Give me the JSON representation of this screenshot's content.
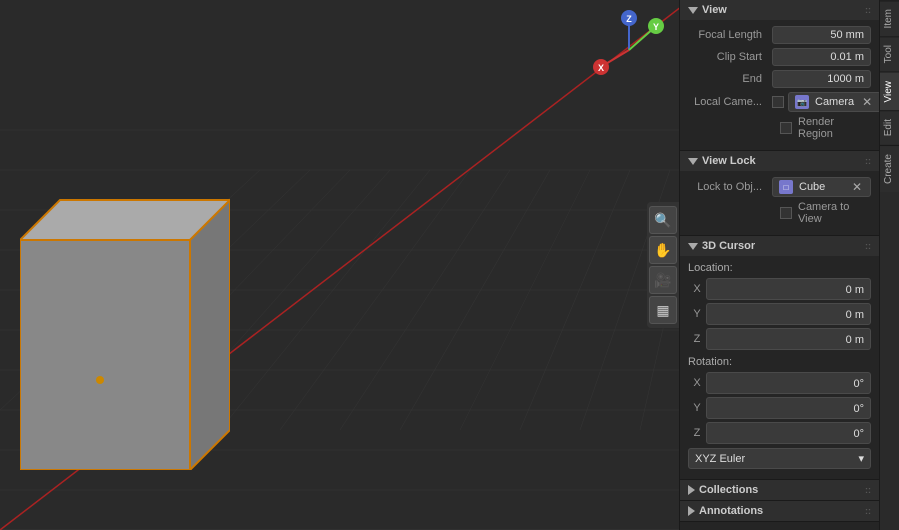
{
  "viewport": {
    "background": "#2a2a2a",
    "grid_color": "#363636",
    "red_line_color": "#cc3333"
  },
  "nav_gizmo": {
    "x_label": "X",
    "y_label": "Y",
    "z_label": "Z",
    "x_color": "#cc3333",
    "y_color": "#66cc44",
    "z_color": "#4466cc"
  },
  "toolbar_buttons": [
    {
      "icon": "🔍",
      "name": "zoom"
    },
    {
      "icon": "✋",
      "name": "pan"
    },
    {
      "icon": "🎥",
      "name": "camera"
    },
    {
      "icon": "▦",
      "name": "grid"
    }
  ],
  "right_panel": {
    "tabs": [
      "Item",
      "Tool",
      "View",
      "Edit",
      "Create"
    ],
    "sections": {
      "view": {
        "title": "View",
        "focal_length_label": "Focal Length",
        "focal_length_value": "50 mm",
        "clip_start_label": "Clip Start",
        "clip_start_value": "0.01 m",
        "end_label": "End",
        "end_value": "1000 m",
        "local_camera_label": "Local Came...",
        "camera_name": "Camera",
        "render_region_label": "Render Region"
      },
      "view_lock": {
        "title": "View Lock",
        "lock_to_obj_label": "Lock to Obj...",
        "lock_obj_name": "Cube",
        "camera_to_view_label": "Camera to View"
      },
      "cursor_3d": {
        "title": "3D Cursor",
        "location_label": "Location:",
        "location_x": "0 m",
        "location_y": "0 m",
        "location_z": "0 m",
        "rotation_label": "Rotation:",
        "rotation_x": "0°",
        "rotation_y": "0°",
        "rotation_z": "0°",
        "rotation_mode": "XYZ Euler"
      },
      "collections": {
        "title": "Collections"
      },
      "annotations": {
        "title": "Annotations"
      }
    }
  }
}
